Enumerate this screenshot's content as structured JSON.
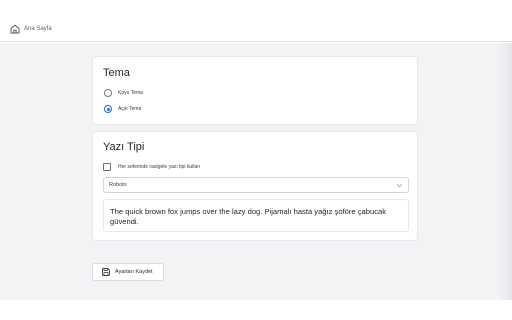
{
  "header": {
    "home_label": "Ana Sayfa",
    "home_icon": "home-icon"
  },
  "theme_card": {
    "title": "Tema",
    "options": [
      {
        "label": "Koyu Tema",
        "selected": false
      },
      {
        "label": "Açık Tema",
        "selected": true
      }
    ]
  },
  "font_card": {
    "title": "Yazı Tipi",
    "random_font_label": "Her seferinde rastgele yazı tipi kullan",
    "random_font_checked": false,
    "selected_font": "Roboto",
    "preview_text": "The quick brown fox jumps over the lazy dog. Pijamalı hasta yağız şoföre çabucak güvendi."
  },
  "actions": {
    "save_label": "Ayarları Kaydet",
    "save_icon": "save-icon"
  },
  "colors": {
    "accent": "#2563eb",
    "background": "#f2f3f5",
    "card": "#ffffff"
  }
}
